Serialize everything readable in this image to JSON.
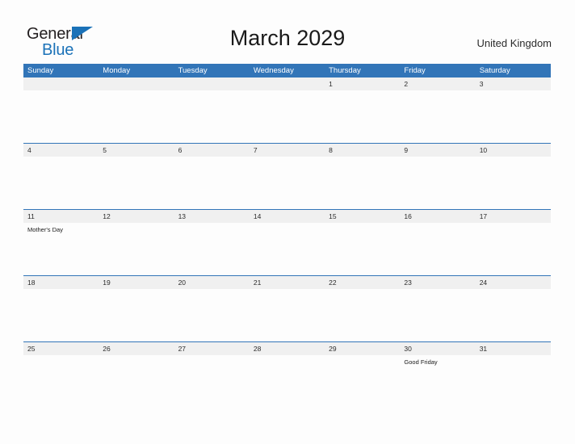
{
  "brand": {
    "name_part1": "General",
    "name_part2": "Blue"
  },
  "header": {
    "title": "March 2029",
    "country": "United Kingdom"
  },
  "colors": {
    "header_blue": "#3275b8",
    "logo_blue": "#1b72b8",
    "date_band": "#f0f0f0",
    "page_background": "#fdfdfd"
  },
  "calendar": {
    "weekdays": [
      "Sunday",
      "Monday",
      "Tuesday",
      "Wednesday",
      "Thursday",
      "Friday",
      "Saturday"
    ],
    "weeks": [
      {
        "dates": [
          "",
          "",
          "",
          "",
          "1",
          "2",
          "3"
        ],
        "events": [
          "",
          "",
          "",
          "",
          "",
          "",
          ""
        ]
      },
      {
        "dates": [
          "4",
          "5",
          "6",
          "7",
          "8",
          "9",
          "10"
        ],
        "events": [
          "",
          "",
          "",
          "",
          "",
          "",
          ""
        ]
      },
      {
        "dates": [
          "11",
          "12",
          "13",
          "14",
          "15",
          "16",
          "17"
        ],
        "events": [
          "Mother's Day",
          "",
          "",
          "",
          "",
          "",
          ""
        ]
      },
      {
        "dates": [
          "18",
          "19",
          "20",
          "21",
          "22",
          "23",
          "24"
        ],
        "events": [
          "",
          "",
          "",
          "",
          "",
          "",
          ""
        ]
      },
      {
        "dates": [
          "25",
          "26",
          "27",
          "28",
          "29",
          "30",
          "31"
        ],
        "events": [
          "",
          "",
          "",
          "",
          "",
          "Good Friday",
          ""
        ]
      }
    ]
  }
}
